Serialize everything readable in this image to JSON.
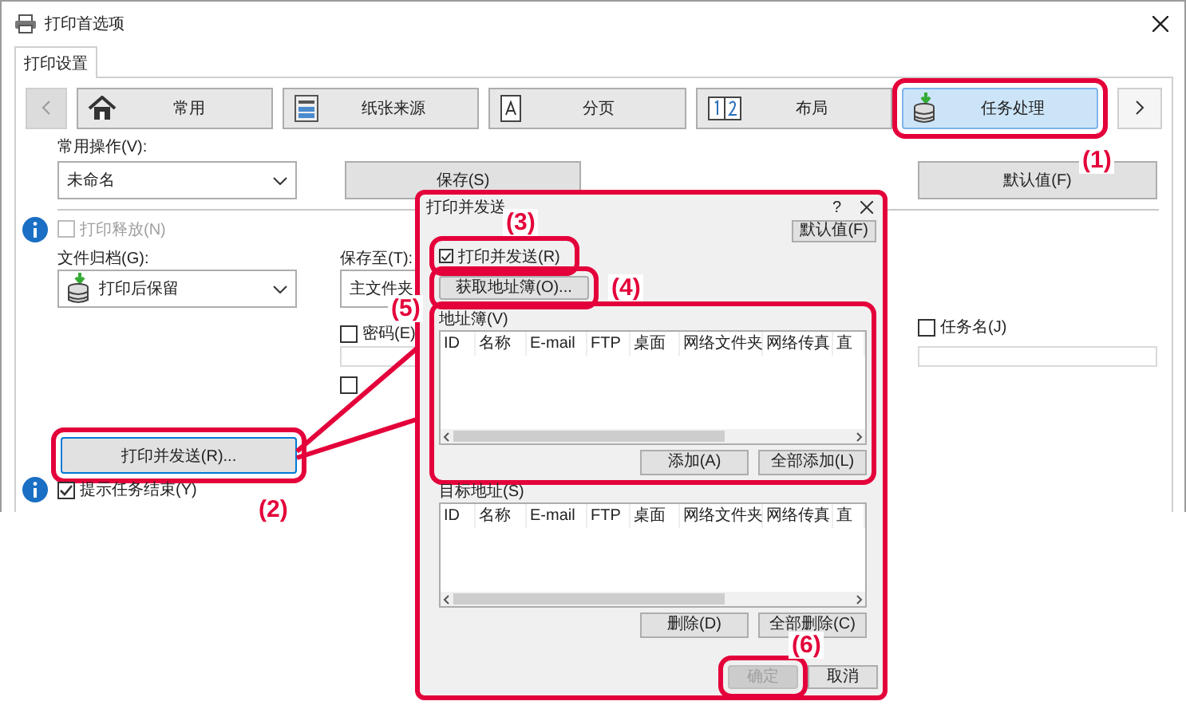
{
  "window": {
    "title": "打印首选项"
  },
  "tabs": [
    {
      "label": "打印设置",
      "selected": true
    }
  ],
  "nav_tabs": [
    {
      "label": "常用",
      "selected": false,
      "highlighted": false
    },
    {
      "label": "纸张来源",
      "selected": false,
      "highlighted": false
    },
    {
      "label": "分页",
      "selected": false,
      "highlighted": false
    },
    {
      "label": "布局",
      "selected": false,
      "highlighted": false
    },
    {
      "label": "任务处理",
      "selected": true,
      "highlighted": true
    }
  ],
  "favorites": {
    "label": "常用操作(V):",
    "value": "未命名",
    "save_button": "保存(S)",
    "default_button": "默认值(F)"
  },
  "print_release": {
    "label": "打印释放(N)",
    "checked": false,
    "disabled": true
  },
  "retention": {
    "label": "文件归档(G):",
    "value": "打印后保留"
  },
  "store_in": {
    "label": "保存至(T):",
    "value": "主文件夹"
  },
  "password": {
    "label": "密码(E)",
    "checked": false
  },
  "unlabeled_option": {
    "checked": false
  },
  "job_name": {
    "label": "任务名(J)",
    "checked": false
  },
  "print_and_send_button": {
    "label": "打印并发送(R)...",
    "highlighted": true
  },
  "notify_job_end": {
    "label": "提示任务结束(Y)",
    "checked": true
  },
  "dialog": {
    "title": "打印并发送",
    "help": "?",
    "highlighted": true,
    "default_button": "默认值(F)",
    "enable": {
      "label": "打印并发送(R)",
      "checked": true,
      "highlighted": true
    },
    "address_book_button": {
      "label": "获取地址簿(O)...",
      "highlighted": true
    },
    "lists": [
      {
        "label": "地址簿(V)",
        "highlighted": true,
        "columns": [
          "ID",
          "名称",
          "E-mail",
          "FTP",
          "桌面",
          "网络文件夹",
          "网络传真",
          "直"
        ],
        "buttons": [
          "添加(A)",
          "全部添加(L)"
        ]
      },
      {
        "label": "目标地址(S)",
        "highlighted": false,
        "columns": [
          "ID",
          "名称",
          "E-mail",
          "FTP",
          "桌面",
          "网络文件夹",
          "网络传真",
          "直"
        ],
        "buttons": [
          "删除(D)",
          "全部删除(C)"
        ]
      }
    ],
    "ok_button": {
      "label": "确定",
      "disabled": true,
      "highlighted": true
    },
    "cancel_button": "取消"
  },
  "callouts": [
    "(1)",
    "(2)",
    "(3)",
    "(4)",
    "(5)",
    "(6)"
  ]
}
